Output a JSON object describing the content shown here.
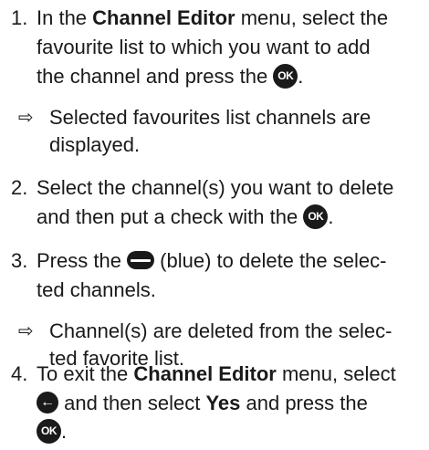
{
  "step1": {
    "number": "1.",
    "line1_pre": "In the ",
    "line1_bold": "Channel Editor",
    "line1_post": " menu, select the",
    "line2": "favourite list to which you want to add",
    "line3_pre": "the channel and press the ",
    "line3_post": ".",
    "ok_icon_label": "OK",
    "icon": "ok-button-icon"
  },
  "result1": {
    "arrow": "⇨",
    "line1": "Selected favourites list channels are",
    "line2": "displayed."
  },
  "step2": {
    "number": "2.",
    "line1": "Select the channel(s) you want to delete",
    "line2_pre": "and then put a check with the ",
    "line2_post": ".",
    "ok_icon_label": "OK",
    "icon": "ok-button-icon"
  },
  "step3": {
    "number": "3.",
    "line1_pre": "Press the ",
    "line1_post": " (blue) to delete the selec-",
    "line2": "ted channels.",
    "icon": "blue-button-icon"
  },
  "result3": {
    "arrow": "⇨",
    "line1": "Channel(s) are deleted from the selec-",
    "line2": "ted favorite list."
  },
  "step4": {
    "number": "4.",
    "line1_pre": "To exit the ",
    "line1_bold": "Channel Editor",
    "line1_post": " menu, select",
    "line2_pre": " and then select ",
    "line2_bold": "Yes",
    "line2_post": " and press the",
    "line3_post": ".",
    "ok_icon_label": "OK",
    "back_icon_glyph": "←",
    "icons": [
      "back-arrow-icon",
      "ok-button-icon"
    ]
  }
}
